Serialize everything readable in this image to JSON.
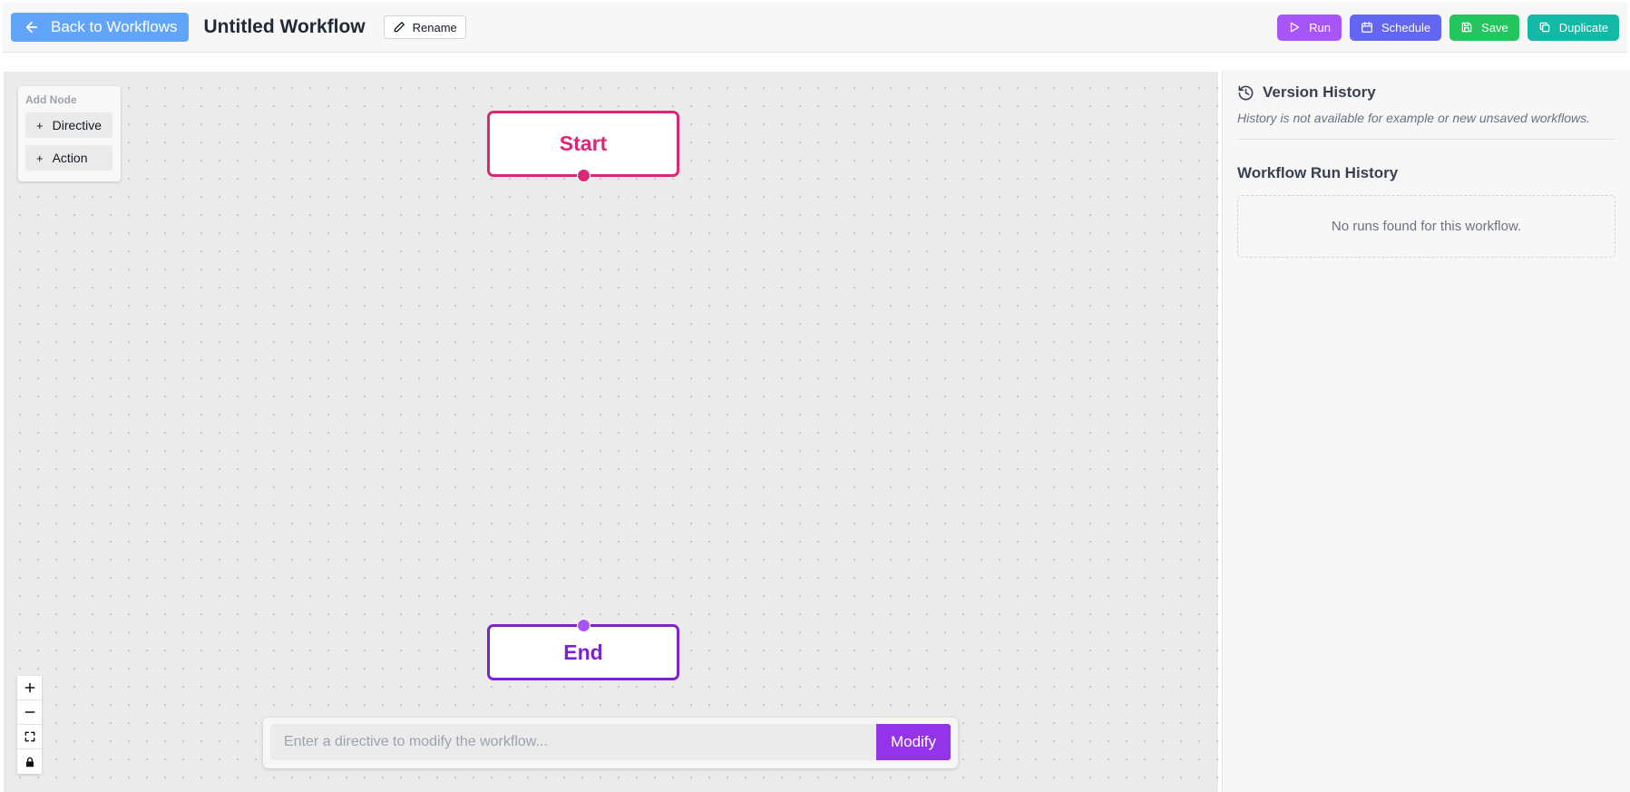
{
  "header": {
    "back_label": "Back to Workflows",
    "title": "Untitled Workflow",
    "rename_label": "Rename",
    "actions": [
      {
        "label": "Run",
        "color": "#a855f7",
        "icon": "play-icon"
      },
      {
        "label": "Schedule",
        "color": "#6366f1",
        "icon": "calendar-icon"
      },
      {
        "label": "Save",
        "color": "#22c55e",
        "icon": "save-icon"
      },
      {
        "label": "Duplicate",
        "color": "#14b8a6",
        "icon": "copy-icon"
      }
    ]
  },
  "add_node": {
    "title": "Add Node",
    "items": [
      {
        "label": "Directive"
      },
      {
        "label": "Action"
      }
    ]
  },
  "nodes": {
    "start": {
      "label": "Start",
      "color": "#db2777"
    },
    "end": {
      "label": "End",
      "color": "#7e22ce"
    }
  },
  "zoom_controls": [
    {
      "icon": "zoom-in-icon"
    },
    {
      "icon": "zoom-out-icon"
    },
    {
      "icon": "fit-view-icon"
    },
    {
      "icon": "lock-icon"
    }
  ],
  "directive": {
    "placeholder": "Enter a directive to modify the workflow...",
    "button_label": "Modify"
  },
  "sidebar": {
    "version_history_title": "Version History",
    "version_history_note": "History is not available for example or new unsaved workflows.",
    "run_history_title": "Workflow Run History",
    "no_runs": "No runs found for this workflow."
  }
}
